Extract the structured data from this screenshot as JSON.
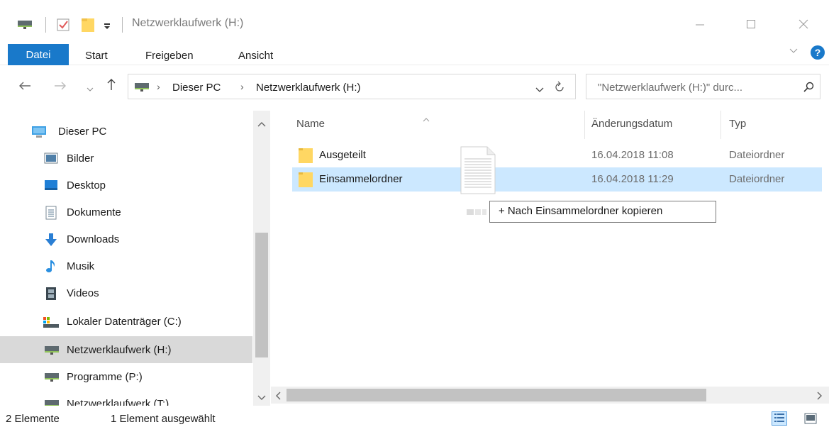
{
  "window": {
    "title": "Netzwerklaufwerk (H:)"
  },
  "ribbon": {
    "tabs": [
      "Datei",
      "Start",
      "Freigeben",
      "Ansicht"
    ],
    "help_label": "?"
  },
  "address": {
    "breadcrumbs": [
      "Dieser PC",
      "Netzwerklaufwerk (H:)"
    ],
    "search_placeholder": "\"Netzwerklaufwerk (H:)\" durc..."
  },
  "navpane": {
    "items": [
      {
        "label": "Dieser PC",
        "icon": "pc-icon"
      },
      {
        "label": "Bilder",
        "icon": "pictures-icon"
      },
      {
        "label": "Desktop",
        "icon": "desktop-icon"
      },
      {
        "label": "Dokumente",
        "icon": "documents-icon"
      },
      {
        "label": "Downloads",
        "icon": "downloads-icon"
      },
      {
        "label": "Musik",
        "icon": "music-icon"
      },
      {
        "label": "Videos",
        "icon": "videos-icon"
      },
      {
        "label": "Lokaler Datenträger (C:)",
        "icon": "local-drive-icon"
      },
      {
        "label": "Netzwerklaufwerk (H:)",
        "icon": "network-drive-icon",
        "selected": true
      },
      {
        "label": "Programme (P:)",
        "icon": "network-drive-icon"
      },
      {
        "label": "Netzwerklaufwerk (T:)",
        "icon": "network-drive-icon"
      }
    ]
  },
  "filelist": {
    "columns": [
      "Name",
      "Änderungsdatum",
      "Typ"
    ],
    "rows": [
      {
        "name": "Ausgeteilt",
        "date": "16.04.2018 11:08",
        "type": "Dateiordner"
      },
      {
        "name": "Einsammelordner",
        "date": "16.04.2018 11:29",
        "type": "Dateiordner",
        "selected": true
      }
    ]
  },
  "drag": {
    "tooltip": "+ Nach Einsammelordner kopieren"
  },
  "status": {
    "count": "2 Elemente",
    "selection": "1 Element ausgewählt"
  },
  "colors": {
    "accent": "#1979ca",
    "selection": "#cce8ff",
    "nav_selected": "#d9d9d9",
    "folder": "#ffd763"
  }
}
